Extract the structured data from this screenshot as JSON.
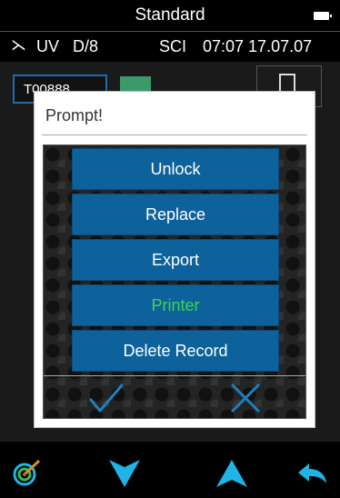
{
  "title_bar": {
    "title": "Standard"
  },
  "status_bar": {
    "bluetooth_icon": "bluetooth-icon",
    "uv": "UV",
    "geometry": "D/8",
    "mode": "SCI",
    "clock": "07:07 17.07.07"
  },
  "background": {
    "sample_name": "T00888",
    "swatch_color": "#3c9a6a"
  },
  "dialog": {
    "title": "Prompt!",
    "options": [
      {
        "label": "Unlock",
        "enabled": true
      },
      {
        "label": "Replace",
        "enabled": true
      },
      {
        "label": "Export",
        "enabled": true
      },
      {
        "label": "Printer",
        "enabled": false
      },
      {
        "label": "Delete Record",
        "enabled": true
      }
    ],
    "confirm_icon": "check-icon",
    "cancel_icon": "x-icon"
  },
  "bottom_nav": {
    "icons": [
      "target-icon",
      "arrow-down-icon",
      "arrow-up-icon",
      "back-arrow-icon"
    ]
  },
  "colors": {
    "option_button": "#0e629c",
    "disabled_text": "#3ed54d",
    "accent_cyan": "#1fb3e6"
  }
}
